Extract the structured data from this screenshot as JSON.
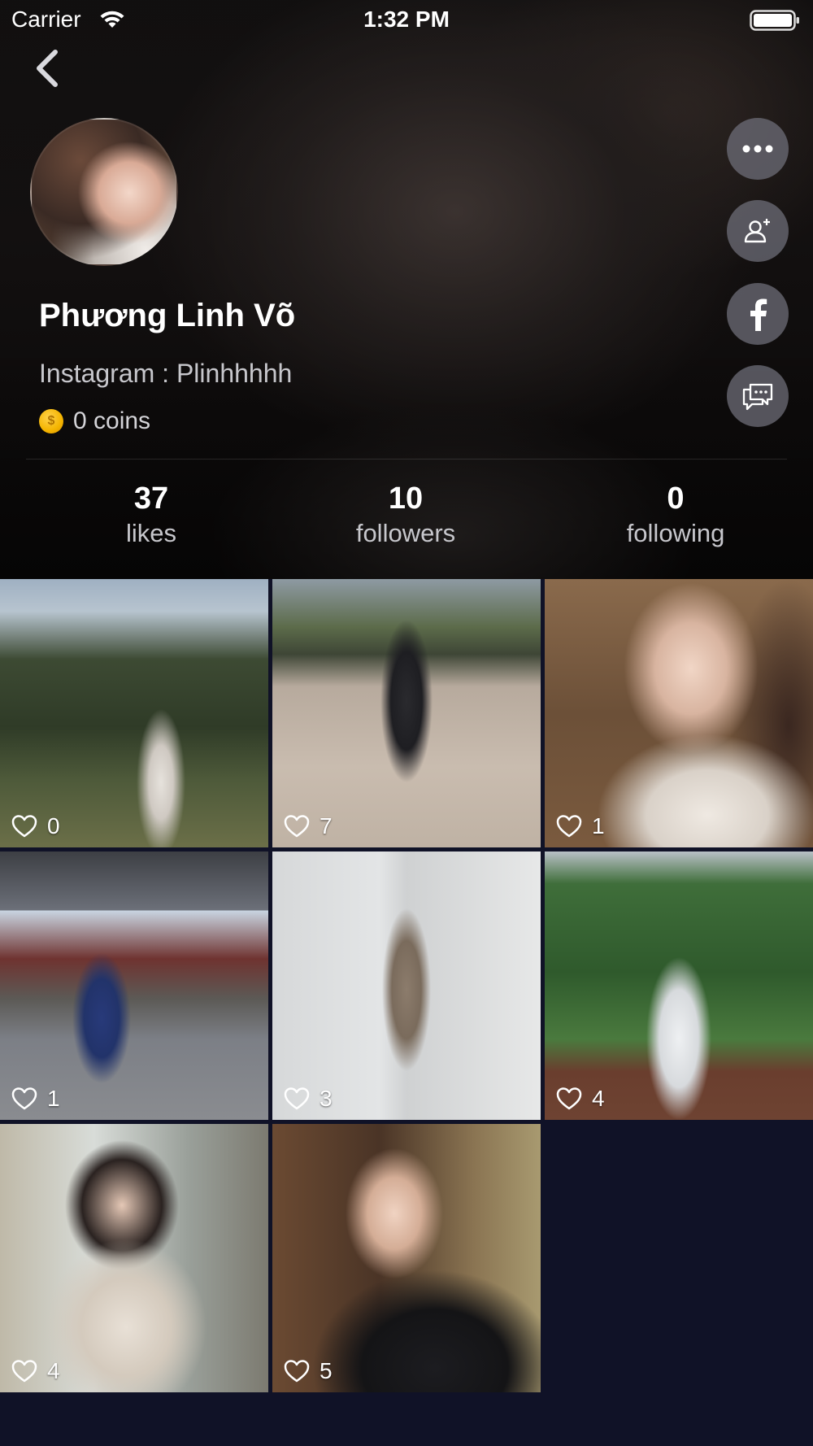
{
  "status_bar": {
    "carrier": "Carrier",
    "time": "1:32 PM"
  },
  "profile": {
    "name": "Phương Linh Võ",
    "instagram": "Instagram : Plinhhhhh",
    "coins": "0 coins"
  },
  "side_actions": [
    {
      "icon": "more-icon"
    },
    {
      "icon": "add-friend-icon"
    },
    {
      "icon": "facebook-icon"
    },
    {
      "icon": "chat-icon"
    }
  ],
  "stats": {
    "likes": {
      "value": "37",
      "label": "likes"
    },
    "followers": {
      "value": "10",
      "label": "followers"
    },
    "following": {
      "value": "0",
      "label": "following"
    }
  },
  "photos": [
    {
      "likes": "0"
    },
    {
      "likes": "7"
    },
    {
      "likes": "1"
    },
    {
      "likes": "1"
    },
    {
      "likes": "3"
    },
    {
      "likes": "4"
    },
    {
      "likes": "4"
    },
    {
      "likes": "5"
    }
  ],
  "colors": {
    "background": "#101227",
    "side_button": "#6e6e78",
    "coin": "#f4b400"
  }
}
